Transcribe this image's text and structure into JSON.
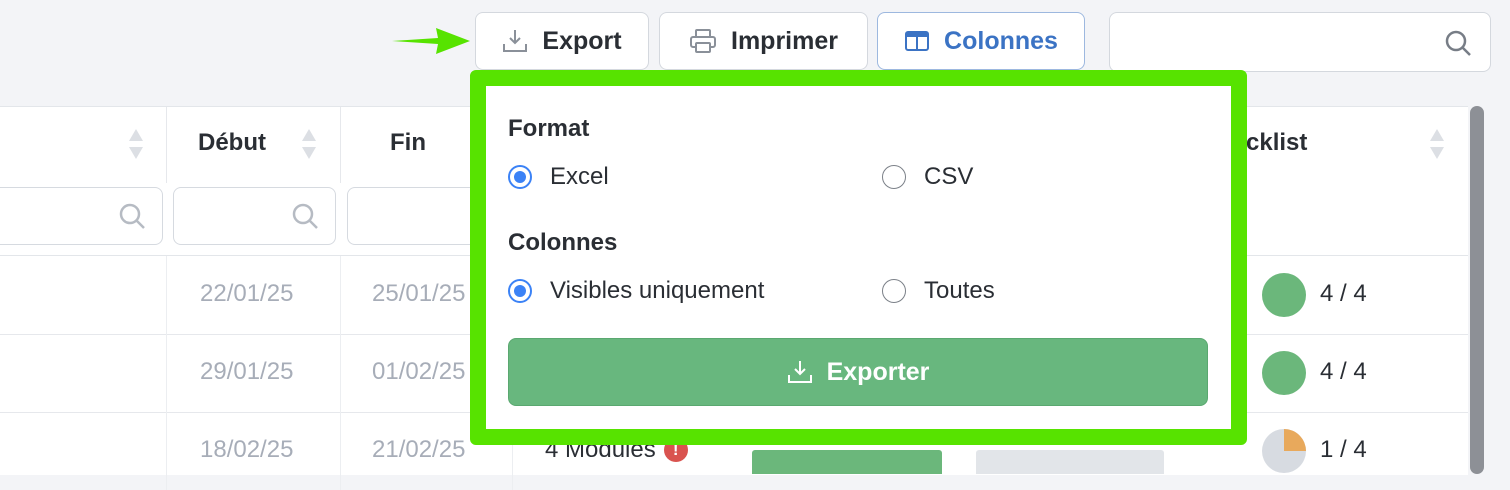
{
  "toolbar": {
    "export_label": "Export",
    "print_label": "Imprimer",
    "columns_label": "Colonnes",
    "search_placeholder": ""
  },
  "table": {
    "headers": [
      "Début",
      "Fin",
      "cklist"
    ],
    "rows": [
      {
        "debut": "22/01/25",
        "fin": "25/01/25",
        "checklist": "4 / 4"
      },
      {
        "debut": "29/01/25",
        "fin": "01/02/25",
        "checklist": "4 / 4"
      },
      {
        "debut": "18/02/25",
        "fin": "21/02/25",
        "modules": "4 Modules",
        "checklist": "1 / 4"
      }
    ]
  },
  "export_popover": {
    "format_label": "Format",
    "format_options": [
      "Excel",
      "CSV"
    ],
    "format_selected": "Excel",
    "columns_label": "Colonnes",
    "columns_options": [
      "Visibles uniquement",
      "Toutes"
    ],
    "columns_selected": "Visibles uniquement",
    "submit_label": "Exporter"
  },
  "colors": {
    "highlight": "#57e300",
    "primary_blue": "#3b73c4",
    "radio_blue": "#3b82f6",
    "success_green": "#68b77e",
    "warning_orange": "#e8a95c",
    "error_red": "#d9534f"
  }
}
